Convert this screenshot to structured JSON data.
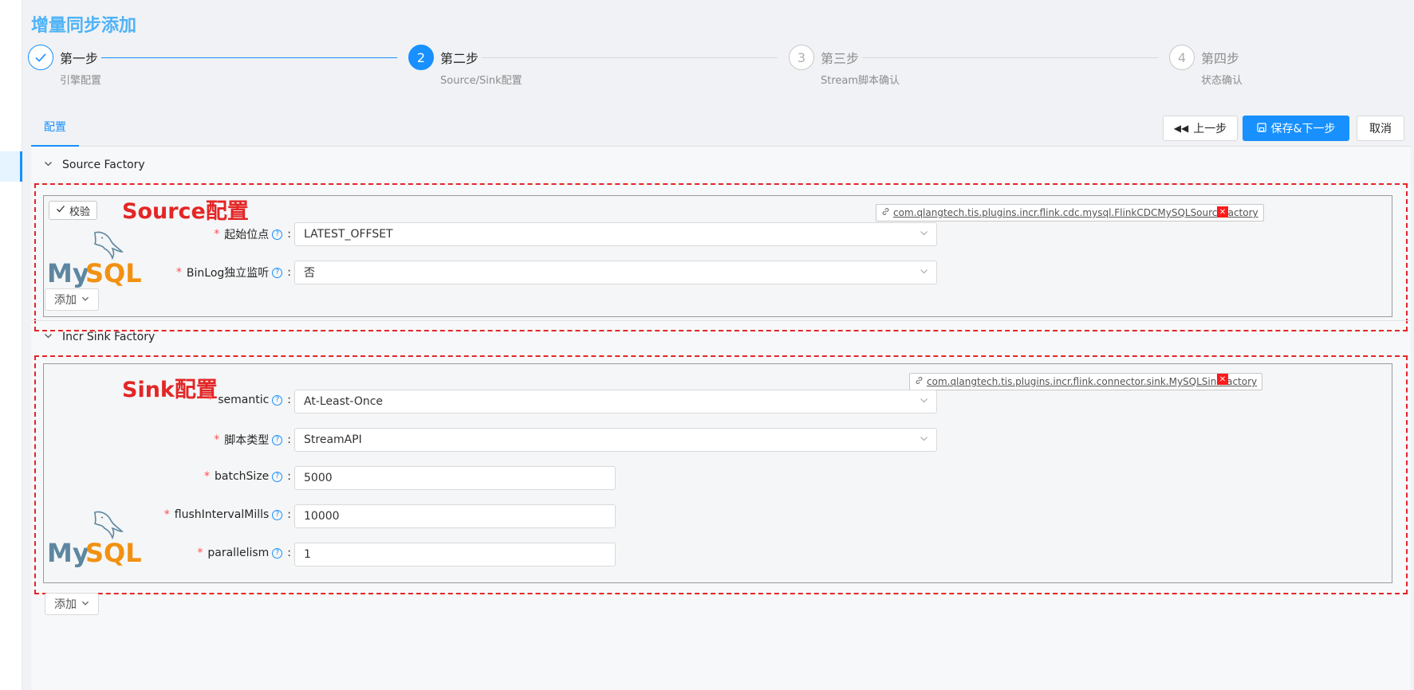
{
  "page": {
    "title": "增量同步添加"
  },
  "steps": [
    {
      "title": "第一步",
      "desc": "引擎配置",
      "status": "done",
      "icon": "check-icon"
    },
    {
      "title": "第二步",
      "desc": "Source/Sink配置",
      "status": "current",
      "number": "2"
    },
    {
      "title": "第三步",
      "desc": "Stream脚本确认",
      "status": "wait",
      "number": "3"
    },
    {
      "title": "第四步",
      "desc": "状态确认",
      "status": "wait",
      "number": "4"
    }
  ],
  "tabs": [
    {
      "label": "配置"
    }
  ],
  "toolbar": {
    "prev_label": "上一步",
    "save_next_label": "保存&下一步",
    "cancel_label": "取消"
  },
  "source": {
    "section_title": "Source Factory",
    "annotation": "Source配置",
    "verify_label": "校验",
    "impl_class": "com.qlangtech.tis.plugins.incr.flink.cdc.mysql.FlinkCDCMySQLSourceFactory",
    "logo_text": "MySQL",
    "fields": [
      {
        "label": "起始位点",
        "value": "LATEST_OFFSET",
        "type": "select"
      },
      {
        "label": "BinLog独立监听",
        "value": "否",
        "type": "select"
      }
    ],
    "add_label": "添加"
  },
  "sink": {
    "section_title": "Incr Sink Factory",
    "annotation": "Sink配置",
    "impl_class": "com.qlangtech.tis.plugins.incr.flink.connector.sink.MySQLSinkFactory",
    "logo_text": "MySQL",
    "fields": [
      {
        "label": "semantic",
        "value": "At-Least-Once",
        "type": "select"
      },
      {
        "label": "脚本类型",
        "value": "StreamAPI",
        "type": "select"
      },
      {
        "label": "batchSize",
        "value": "5000",
        "type": "input"
      },
      {
        "label": "flushIntervalMills",
        "value": "10000",
        "type": "input"
      },
      {
        "label": "parallelism",
        "value": "1",
        "type": "input"
      }
    ],
    "add_label": "添加"
  },
  "colors": {
    "primary": "#1890ff",
    "title": "#4fb3f6",
    "annotation": "#e32626",
    "required": "#ff4d4f",
    "delete": "#ff1a1a"
  }
}
